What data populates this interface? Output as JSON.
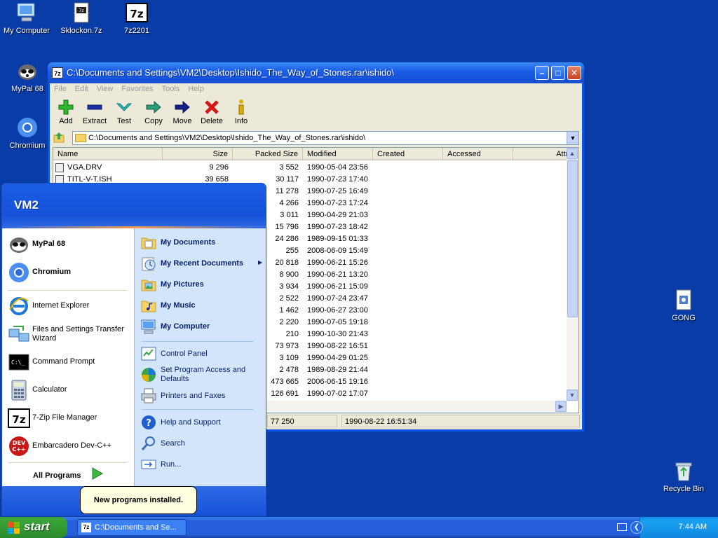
{
  "desktop": {
    "icons": [
      {
        "label": "My Computer"
      },
      {
        "label": "Sklockon.7z"
      },
      {
        "label": "7z2201"
      },
      {
        "label": "MyPal 68"
      },
      {
        "label": "Chromium"
      },
      {
        "label": "GONG"
      },
      {
        "label": "Recycle Bin"
      }
    ]
  },
  "window": {
    "title": "C:\\Documents and Settings\\VM2\\Desktop\\Ishido_The_Way_of_Stones.rar\\ishido\\",
    "app_icon": "7z",
    "menu": [
      "File",
      "Edit",
      "View",
      "Favorites",
      "Tools",
      "Help"
    ],
    "toolbar": [
      "Add",
      "Extract",
      "Test",
      "Copy",
      "Move",
      "Delete",
      "Info"
    ],
    "address": "C:\\Documents and Settings\\VM2\\Desktop\\Ishido_The_Way_of_Stones.rar\\ishido\\",
    "columns": [
      "Name",
      "Size",
      "Packed Size",
      "Modified",
      "Created",
      "Accessed",
      "Attribu"
    ],
    "rows": [
      {
        "name": "VGA.DRV",
        "size": "9 296",
        "packed": "3 552",
        "modified": "1990-05-04 23:56"
      },
      {
        "name": "TITL-V-T.ISH",
        "size": "39 658",
        "packed": "30 117",
        "modified": "1990-07-23 17:40"
      },
      {
        "name": "",
        "size": "",
        "packed": "11 278",
        "modified": "1990-07-25 16:49"
      },
      {
        "name": "",
        "size": "",
        "packed": "4 266",
        "modified": "1990-07-23 17:24"
      },
      {
        "name": "",
        "size": "",
        "packed": "3 011",
        "modified": "1990-04-29 21:03"
      },
      {
        "name": "",
        "size": "",
        "packed": "15 796",
        "modified": "1990-07-23 18:42"
      },
      {
        "name": "",
        "size": "",
        "packed": "24 286",
        "modified": "1989-09-15 01:33"
      },
      {
        "name": "",
        "size": "",
        "packed": "255",
        "modified": "2008-06-09 15:49"
      },
      {
        "name": "",
        "size": "",
        "packed": "20 818",
        "modified": "1990-06-21 15:26"
      },
      {
        "name": "",
        "size": "",
        "packed": "8 900",
        "modified": "1990-06-21 13:20"
      },
      {
        "name": "",
        "size": "",
        "packed": "3 934",
        "modified": "1990-06-21 15:09"
      },
      {
        "name": "",
        "size": "",
        "packed": "2 522",
        "modified": "1990-07-24 23:47"
      },
      {
        "name": "",
        "size": "",
        "packed": "1 462",
        "modified": "1990-06-27 23:00"
      },
      {
        "name": "",
        "size": "",
        "packed": "2 220",
        "modified": "1990-07-05 19:18"
      },
      {
        "name": "",
        "size": "",
        "packed": "210",
        "modified": "1990-10-30 21:43"
      },
      {
        "name": "",
        "size": "",
        "packed": "73 973",
        "modified": "1990-08-22 16:51"
      },
      {
        "name": "",
        "size": "",
        "packed": "3 109",
        "modified": "1990-04-29 01:25"
      },
      {
        "name": "",
        "size": "",
        "packed": "2 478",
        "modified": "1989-08-29 21:44"
      },
      {
        "name": "",
        "size": "",
        "packed": "473 665",
        "modified": "2006-06-15 19:16"
      },
      {
        "name": "",
        "size": "",
        "packed": "126 691",
        "modified": "1990-07-02 17:07"
      }
    ],
    "status": {
      "size": "77 250",
      "modified": "1990-08-22 16:51:34"
    }
  },
  "start_menu": {
    "user": "VM2",
    "pinned": [
      {
        "label": "MyPal 68"
      },
      {
        "label": "Chromium"
      }
    ],
    "recent": [
      {
        "label": "Internet Explorer"
      },
      {
        "label": "Files and Settings Transfer Wizard"
      },
      {
        "label": "Command Prompt"
      },
      {
        "label": "Calculator"
      },
      {
        "label": "7-Zip File Manager"
      },
      {
        "label": "Embarcadero Dev-C++"
      }
    ],
    "all_programs": "All Programs",
    "right": {
      "my_documents": "My Documents",
      "my_recent_documents": "My Recent Documents",
      "my_pictures": "My Pictures",
      "my_music": "My Music",
      "my_computer": "My Computer",
      "control_panel": "Control Panel",
      "set_program_access": "Set Program Access and Defaults",
      "printers": "Printers and Faxes",
      "help": "Help and Support",
      "search": "Search",
      "run": "Run..."
    }
  },
  "balloon": "New programs installed.",
  "taskbar": {
    "start": "start",
    "task_label": "C:\\Documents and Se...",
    "clock": "7:44 AM"
  }
}
